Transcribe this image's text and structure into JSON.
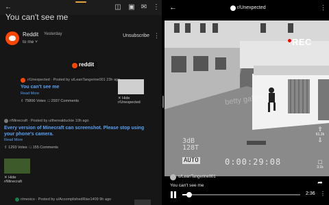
{
  "email": {
    "subject": "You can't see me",
    "sender": {
      "name": "Reddit",
      "time": "Yesterday",
      "to": "to me"
    },
    "unsubscribe_label": "Unsubscribe",
    "brand_word": "reddit",
    "hide_label": "Hide",
    "posts": [
      {
        "meta": "r/Unexpected · Posted by u/LeanTangerine001 23h ago",
        "title": "You can't see me",
        "read_more": "Read More",
        "votes": "75800 Votes",
        "comments": "2937 Comments",
        "community": "r/Unexpected"
      },
      {
        "meta": "r/Minecraft · Posted by u/therealduckie 10h ago",
        "title": "Every version of Minecraft can screenshot. Please stop using your phone's camera.",
        "read_more": "Read More",
        "votes": "1293 Votes",
        "comments": "155 Comments",
        "community": "r/Minecraft"
      },
      {
        "meta": "r/mexico · Posted by u/AccomplishedRise1409 9h ago"
      }
    ]
  },
  "video": {
    "subreddit": "r/Unexpected",
    "rec_label": "REC",
    "watermark": "betty gallery",
    "osd_line1": "3dB",
    "osd_line2": "128T",
    "osd_auto": "AUTO",
    "osd_time": "0:00:29:08",
    "author": "u/LeanTangerine001",
    "caption": "You can't see me",
    "upvotes": "61.2k",
    "comments": "3.1k",
    "duration": "2:36",
    "progress": 0.06
  },
  "colors": {
    "link": "#5aa3f5",
    "reddit_orange": "#ff4500",
    "accent_bar": "#e8a23a"
  }
}
